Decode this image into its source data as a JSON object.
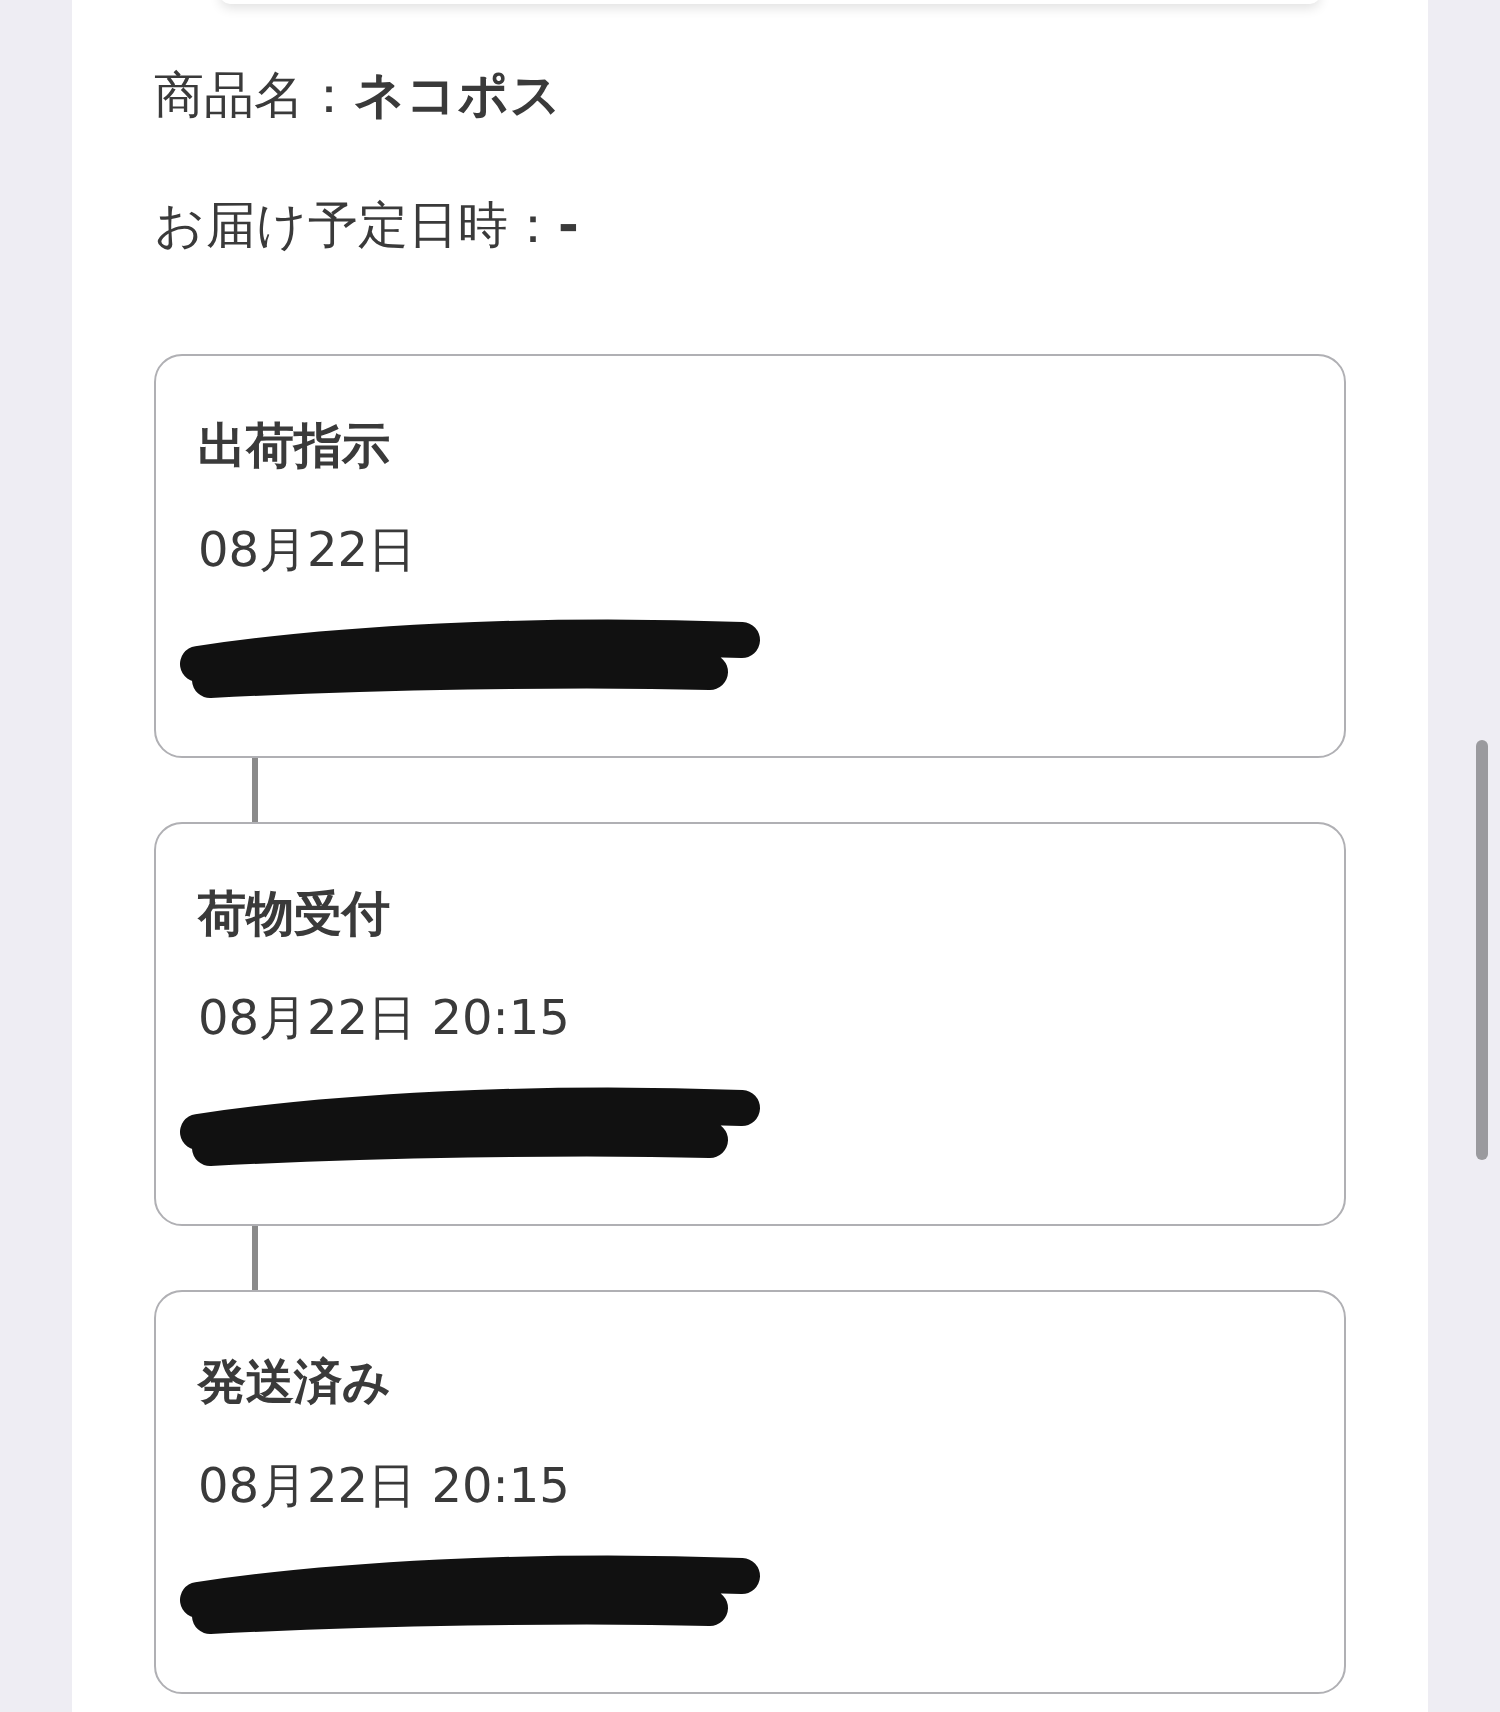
{
  "product": {
    "label": "商品名：",
    "value": "ネコポス"
  },
  "delivery": {
    "label": "お届け予定日時：",
    "value": "-"
  },
  "events": [
    {
      "status": "出荷指示",
      "datetime": "08月22日"
    },
    {
      "status": "荷物受付",
      "datetime": "08月22日 20:15"
    },
    {
      "status": "発送済み",
      "datetime": "08月22日 20:15"
    }
  ]
}
